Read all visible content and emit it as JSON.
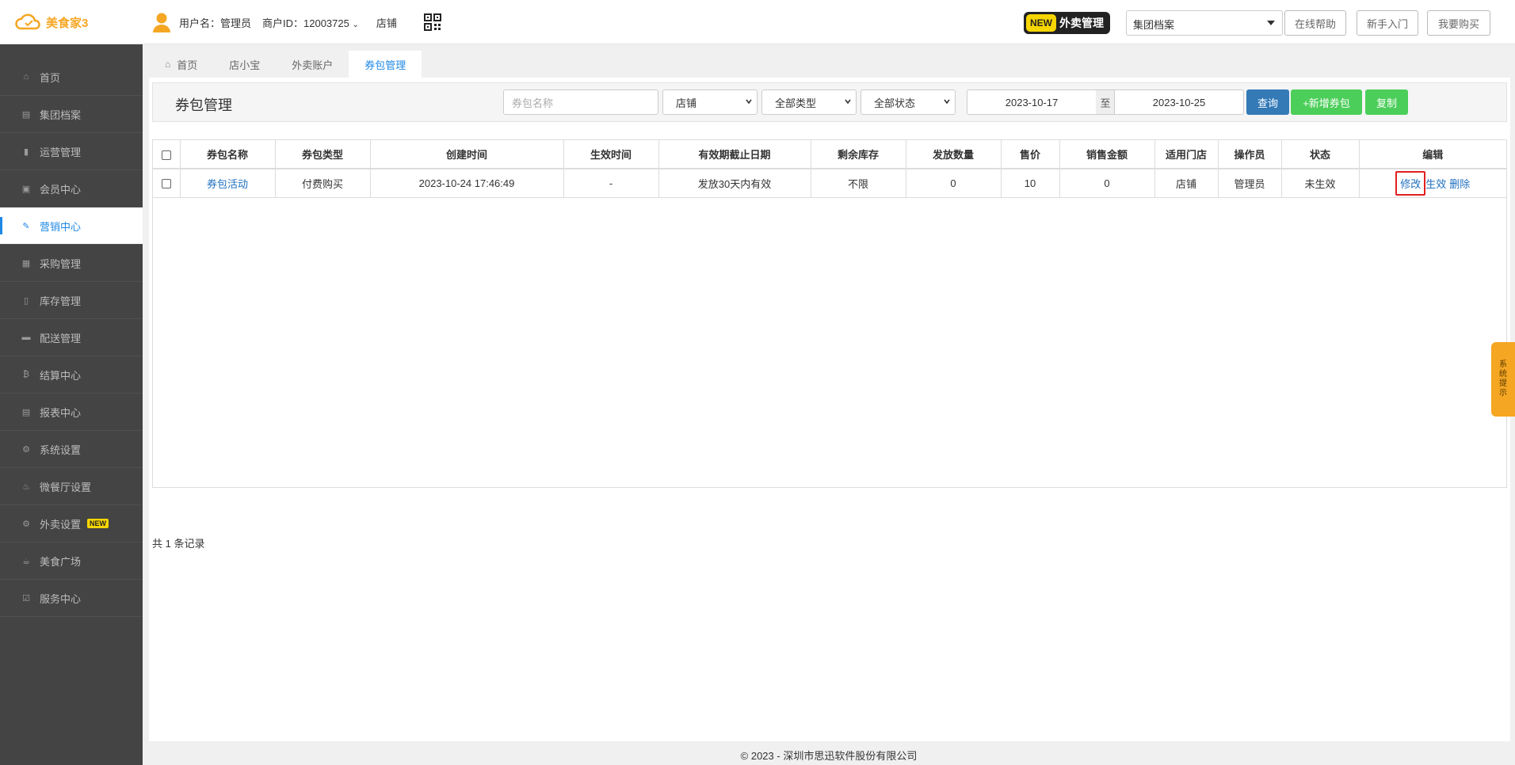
{
  "header": {
    "brand": "美食家3",
    "username": "用户名：管理员",
    "merchant_id": "商户ID：12003725",
    "store": "店铺",
    "new_tag": "NEW",
    "new_label": "外卖管理",
    "archive_select": "集团档案",
    "help": "在线帮助",
    "guide": "新手入门",
    "buy": "我要购买"
  },
  "sidebar": {
    "items": [
      {
        "label": "首页",
        "icon": "home-icon"
      },
      {
        "label": "集团档案",
        "icon": "file-icon"
      },
      {
        "label": "运营管理",
        "icon": "bar-chart-icon"
      },
      {
        "label": "会员中心",
        "icon": "member-card-icon"
      },
      {
        "label": "营销中心",
        "icon": "edit-icon"
      },
      {
        "label": "采购管理",
        "icon": "book-icon"
      },
      {
        "label": "库存管理",
        "icon": "inventory-icon"
      },
      {
        "label": "配送管理",
        "icon": "truck-icon"
      },
      {
        "label": "结算中心",
        "icon": "bitcoin-icon"
      },
      {
        "label": "报表中心",
        "icon": "report-icon"
      },
      {
        "label": "系统设置",
        "icon": "gears-icon"
      },
      {
        "label": "微餐厅设置",
        "icon": "cutlery-icon"
      },
      {
        "label": "外卖设置",
        "icon": "gear-icon",
        "badge": "NEW"
      },
      {
        "label": "美食广场",
        "icon": "coffee-icon"
      },
      {
        "label": "服务中心",
        "icon": "check-square-icon"
      }
    ],
    "active_index": 4
  },
  "tabs": [
    {
      "label": "首页"
    },
    {
      "label": "店小宝"
    },
    {
      "label": "外卖账户"
    },
    {
      "label": "券包管理"
    }
  ],
  "toolbar": {
    "title": "券包管理",
    "name_placeholder": "券包名称",
    "store_select": "店铺",
    "type_select": "全部类型",
    "status_select": "全部状态",
    "date_from": "2023-10-17",
    "date_sep": "至",
    "date_to": "2023-10-25",
    "query": "查询",
    "add": "+新增券包",
    "copy": "复制"
  },
  "table": {
    "headers": [
      "券包名称",
      "券包类型",
      "创建时间",
      "生效时间",
      "有效期截止日期",
      "剩余库存",
      "发放数量",
      "售价",
      "销售金额",
      "适用门店",
      "操作员",
      "状态",
      "编辑"
    ],
    "rows": [
      {
        "name": "券包活动",
        "type": "付费购买",
        "created": "2023-10-24 17:46:49",
        "effective": "-",
        "expiry": "发放30天内有效",
        "stock": "不限",
        "issued": "0",
        "price": "10",
        "sales": "0",
        "store": "店铺",
        "operator": "管理员",
        "status": "未生效",
        "actions": {
          "modify": "修改",
          "activate": "生效",
          "delete": "删除"
        }
      }
    ]
  },
  "record_count": "共 1 条记录",
  "footer": "© 2023 - 深圳市思迅软件股份有限公司",
  "side_tab": [
    "系",
    "统",
    "提",
    "示"
  ],
  "colors": {
    "accent": "#1e88e5",
    "brand": "#f5a623",
    "sidebar_bg": "#444444",
    "query_btn": "#337ab7",
    "add_btn": "#4cce5a",
    "highlight": "#e02020"
  }
}
